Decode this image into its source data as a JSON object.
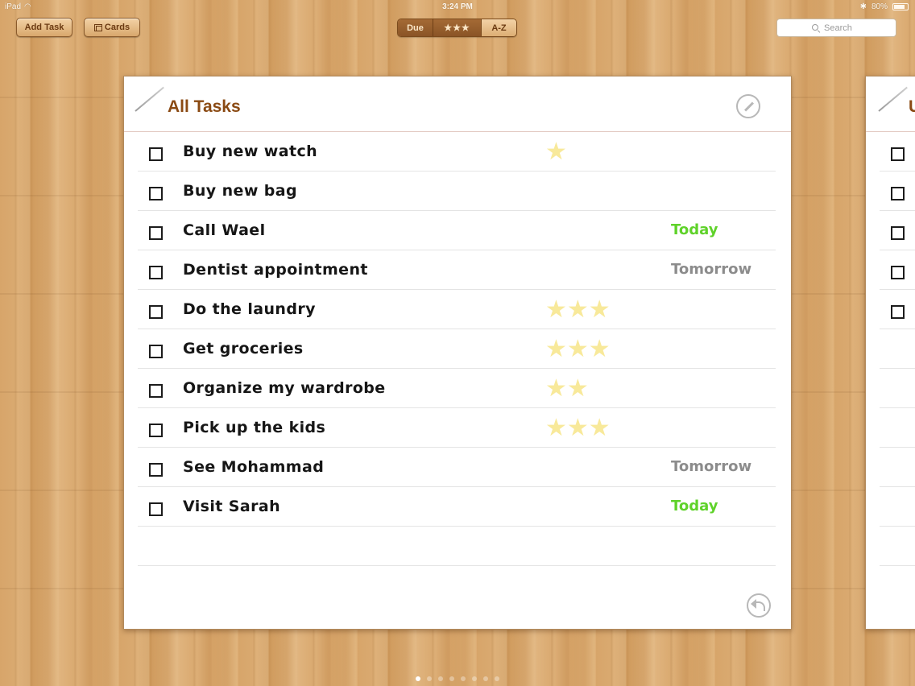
{
  "status_bar": {
    "device": "iPad",
    "time": "3:24 PM",
    "battery": "80%"
  },
  "toolbar": {
    "add_task_label": "Add Task",
    "cards_label": "Cards",
    "sort": {
      "options": [
        "Due",
        "★★★",
        "A-Z"
      ],
      "selected": "A-Z"
    },
    "search_placeholder": "Search"
  },
  "list": {
    "title": "All Tasks",
    "tasks": [
      {
        "name": "Buy new  watch",
        "stars": "★",
        "due": ""
      },
      {
        "name": "Buy new bag",
        "stars": "",
        "due": ""
      },
      {
        "name": "Call Wael",
        "stars": "",
        "due": "Today"
      },
      {
        "name": "Dentist appointment",
        "stars": "",
        "due": "Tomorrow"
      },
      {
        "name": "Do the laundry",
        "stars": "★★★",
        "due": ""
      },
      {
        "name": "Get groceries",
        "stars": "★★★",
        "due": ""
      },
      {
        "name": "Organize my wardrobe",
        "stars": "★★",
        "due": ""
      },
      {
        "name": "Pick up the kids",
        "stars": "★★★",
        "due": ""
      },
      {
        "name": "See Mohammad",
        "stars": "",
        "due": "Tomorrow"
      },
      {
        "name": "Visit Sarah",
        "stars": "",
        "due": "Today"
      }
    ]
  },
  "next_card": {
    "title_peek": "U"
  },
  "pager": {
    "pages": 8,
    "current": 1
  },
  "colors": {
    "title_brown": "#8a4a13",
    "today_green": "#5fd22a",
    "tomorrow_gray": "#8c8c8c",
    "star_yellow": "#f8e99a"
  }
}
